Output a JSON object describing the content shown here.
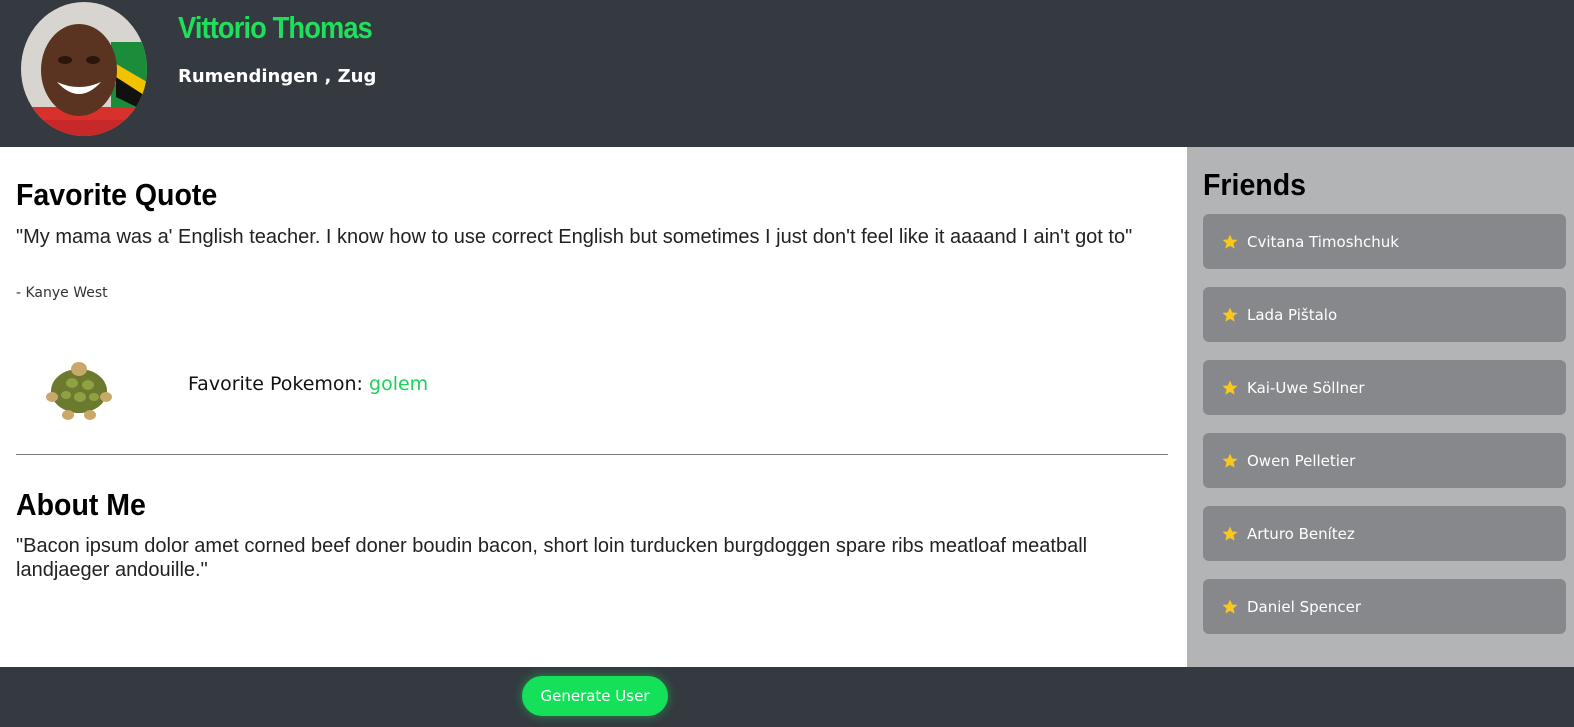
{
  "user": {
    "name": "Vittorio Thomas",
    "location": "Rumendingen , Zug"
  },
  "quote": {
    "title": "Favorite Quote",
    "text": "\"My mama was a' English teacher. I know how to use correct English but sometimes I just don't feel like it aaaand I ain't got to\"",
    "author": "- Kanye West"
  },
  "pokemon": {
    "label": "Favorite Pokemon: ",
    "name": "golem"
  },
  "about": {
    "title": "About Me",
    "text": "\"Bacon ipsum dolor amet corned beef doner boudin bacon, short loin turducken burgdoggen spare ribs meatloaf meatball landjaeger andouille.\""
  },
  "friends": {
    "title": "Friends",
    "items": [
      {
        "name": "Cvitana Timoshchuk",
        "icon": "star-icon"
      },
      {
        "name": "Lada Pištalo",
        "icon": "star-icon"
      },
      {
        "name": "Kai-Uwe Söllner",
        "icon": "star-icon"
      },
      {
        "name": "Owen Pelletier",
        "icon": "star-icon"
      },
      {
        "name": "Arturo Benítez",
        "icon": "star-icon"
      },
      {
        "name": "Daniel Spencer",
        "icon": "star-icon"
      }
    ]
  },
  "footer": {
    "generate_label": "Generate User"
  },
  "colors": {
    "accent": "#1ee05a",
    "header_bg": "#343a40",
    "sidebar_bg": "#b3b4b6",
    "friend_card_bg": "#87888b",
    "star": "#f9c81e"
  }
}
